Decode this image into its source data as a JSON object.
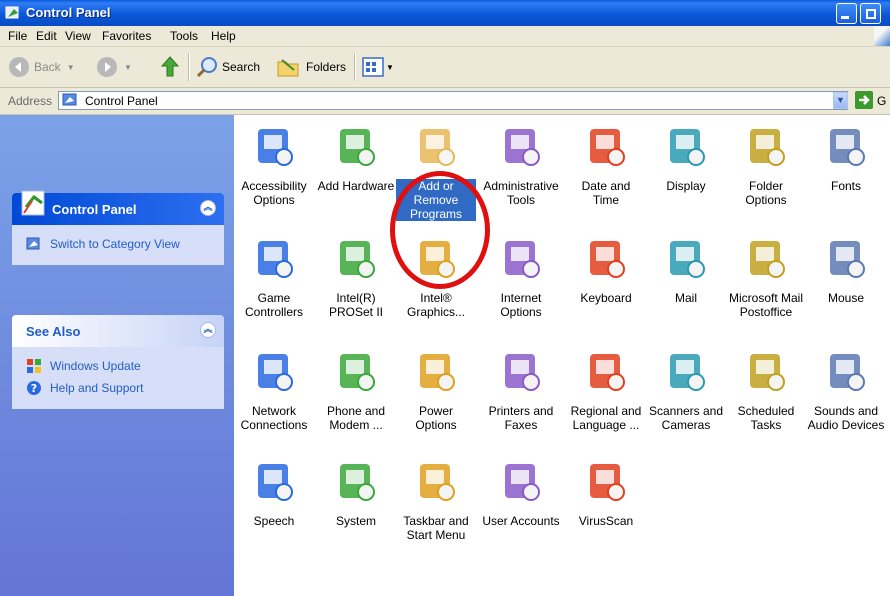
{
  "window": {
    "title": "Control Panel"
  },
  "menu": [
    "File",
    "Edit",
    "View",
    "Favorites",
    "Tools",
    "Help"
  ],
  "toolbar": {
    "back": "Back",
    "search": "Search",
    "folders": "Folders"
  },
  "address": {
    "label": "Address",
    "value": "Control Panel",
    "go": "G"
  },
  "sidebar": {
    "control_panel": {
      "title": "Control Panel",
      "switch_view": "Switch to Category View"
    },
    "see_also": {
      "title": "See Also",
      "links": [
        "Windows Update",
        "Help and Support"
      ]
    }
  },
  "items": [
    {
      "label": "Accessibility\nOptions",
      "icon": "accessibility-icon"
    },
    {
      "label": "Add Hardware",
      "icon": "add-hardware-icon"
    },
    {
      "label": "Add or\nRemove\nPrograms",
      "icon": "add-remove-programs-icon",
      "selected": true
    },
    {
      "label": "Administrative\nTools",
      "icon": "administrative-tools-icon"
    },
    {
      "label": "Date and Time",
      "icon": "date-time-icon"
    },
    {
      "label": "Display",
      "icon": "display-icon"
    },
    {
      "label": "Folder Options",
      "icon": "folder-options-icon"
    },
    {
      "label": "Fonts",
      "icon": "fonts-icon"
    },
    {
      "label": "Game\nControllers",
      "icon": "game-controllers-icon"
    },
    {
      "label": "Intel(R)\nPROSet II",
      "icon": "intel-proset-icon"
    },
    {
      "label": "Intel®\nGraphics...",
      "icon": "intel-graphics-icon"
    },
    {
      "label": "Internet\nOptions",
      "icon": "internet-options-icon"
    },
    {
      "label": "Keyboard",
      "icon": "keyboard-icon"
    },
    {
      "label": "Mail",
      "icon": "mail-icon"
    },
    {
      "label": "Microsoft Mail\nPostoffice",
      "icon": "mail-postoffice-icon"
    },
    {
      "label": "Mouse",
      "icon": "mouse-icon"
    },
    {
      "label": "Network\nConnections",
      "icon": "network-connections-icon"
    },
    {
      "label": "Phone and\nModem ...",
      "icon": "phone-modem-icon"
    },
    {
      "label": "Power Options",
      "icon": "power-options-icon"
    },
    {
      "label": "Printers and\nFaxes",
      "icon": "printers-faxes-icon"
    },
    {
      "label": "Regional and\nLanguage ...",
      "icon": "regional-language-icon"
    },
    {
      "label": "Scanners and\nCameras",
      "icon": "scanners-cameras-icon"
    },
    {
      "label": "Scheduled\nTasks",
      "icon": "scheduled-tasks-icon"
    },
    {
      "label": "Sounds and\nAudio Devices",
      "icon": "sounds-audio-icon"
    },
    {
      "label": "Speech",
      "icon": "speech-icon"
    },
    {
      "label": "System",
      "icon": "system-icon"
    },
    {
      "label": "Taskbar and\nStart Menu",
      "icon": "taskbar-startmenu-icon"
    },
    {
      "label": "User Accounts",
      "icon": "user-accounts-icon"
    },
    {
      "label": "VirusScan",
      "icon": "virusscan-icon"
    }
  ],
  "colors": {
    "titlebar": "#0b58d8",
    "sidebar": "#6f8ee0",
    "selection": "#316ac5",
    "annotation_ring": "#e01010"
  }
}
